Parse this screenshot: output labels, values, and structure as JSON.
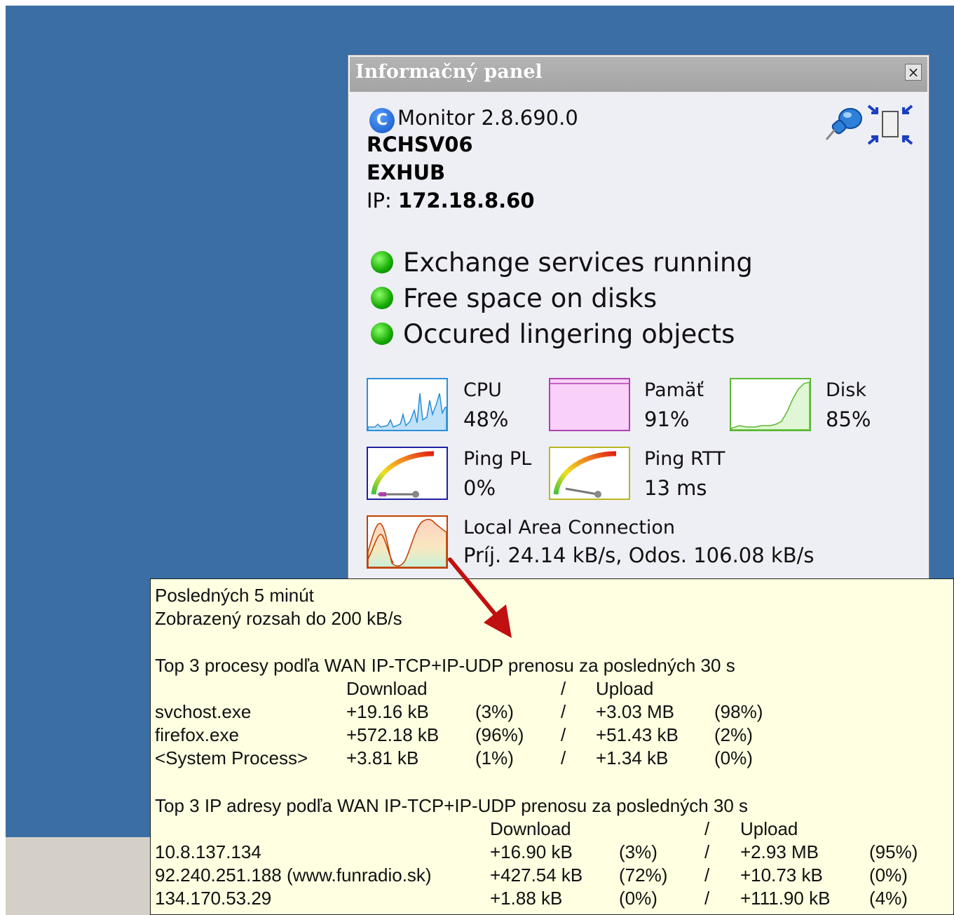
{
  "panel": {
    "title": "Informačný panel",
    "close_label": "×",
    "app_name": "Monitor 2.8.690.0",
    "app_logo_letter": "C",
    "server": "RCHSV06",
    "group": "EXHUB",
    "ip_label": "IP:",
    "ip_value": "172.18.8.60",
    "statuses": [
      {
        "label": "Exchange services running",
        "color": "#13a800"
      },
      {
        "label": "Free space on disks",
        "color": "#13a800"
      },
      {
        "label": "Occured lingering objects",
        "color": "#13a800"
      }
    ],
    "metrics": {
      "cpu": {
        "label": "CPU",
        "value": "48%",
        "level": 48,
        "color": "#2a8fd6"
      },
      "memory": {
        "label": "Pamäť",
        "value": "91%",
        "level": 91,
        "color": "#b040b0"
      },
      "disk": {
        "label": "Disk",
        "value": "85%",
        "level": 85,
        "color": "#5ab830"
      },
      "ping_pl": {
        "label": "Ping PL",
        "value": "0%",
        "color": "#2020a0"
      },
      "ping_rtt": {
        "label": "Ping RTT",
        "value": "13 ms",
        "color": "#b8b820"
      },
      "network": {
        "label": "Local Area Connection",
        "value": "Príj. 24.14 kB/s, Odos. 106.08 kB/s",
        "color": "#c04000"
      }
    }
  },
  "tooltip": {
    "line1": "Posledných 5 minút",
    "line2": "Zobrazený rozsah do 200 kB/s",
    "processes": {
      "heading": "Top 3 procesy podľa WAN IP-TCP+IP-UDP prenosu za posledných 30 s",
      "col_download": "Download",
      "col_sep": "/",
      "col_upload": "Upload",
      "rows": [
        {
          "name": "svchost.exe",
          "down": "+19.16 kB",
          "down_pct": "(3%)",
          "sep": "/",
          "up": "+3.03 MB",
          "up_pct": "(98%)"
        },
        {
          "name": "firefox.exe",
          "down": "+572.18 kB",
          "down_pct": "(96%)",
          "sep": "/",
          "up": "+51.43 kB",
          "up_pct": "(2%)"
        },
        {
          "name": "<System Process>",
          "down": "+3.81 kB",
          "down_pct": "(1%)",
          "sep": "/",
          "up": "+1.34 kB",
          "up_pct": "(0%)"
        }
      ]
    },
    "ips": {
      "heading": "Top 3 IP adresy podľa WAN IP-TCP+IP-UDP prenosu za posledných 30 s",
      "col_download": "Download",
      "col_sep": "/",
      "col_upload": "Upload",
      "rows": [
        {
          "name": "10.8.137.134",
          "down": "+16.90 kB",
          "down_pct": "(3%)",
          "sep": "/",
          "up": "+2.93 MB",
          "up_pct": "(95%)"
        },
        {
          "name": "92.240.251.188 (www.funradio.sk)",
          "down": "+427.54 kB",
          "down_pct": "(72%)",
          "sep": "/",
          "up": "+10.73 kB",
          "up_pct": "(0%)"
        },
        {
          "name": "134.170.53.29",
          "down": "+1.88 kB",
          "down_pct": "(0%)",
          "sep": "/",
          "up": "+111.90 kB",
          "up_pct": "(4%)"
        }
      ]
    }
  }
}
